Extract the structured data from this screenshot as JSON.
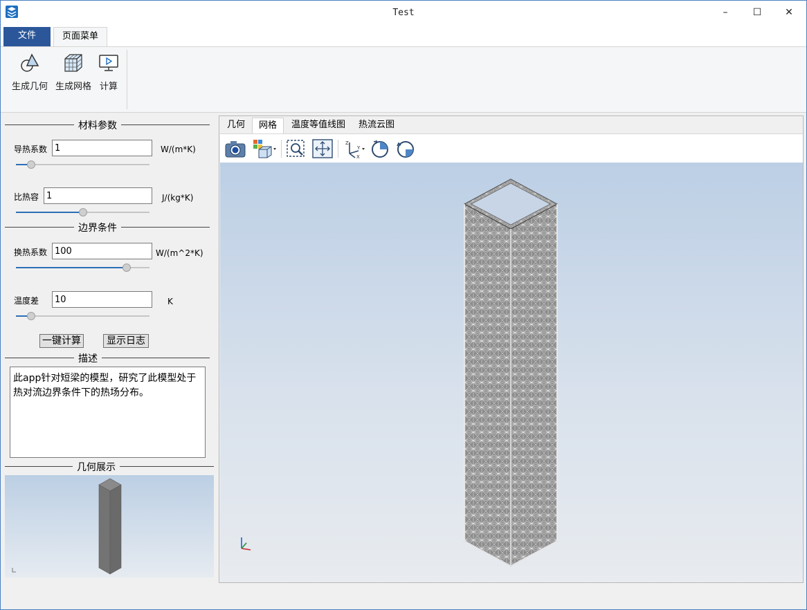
{
  "window": {
    "title": "Test",
    "minimize": "–",
    "maximize": "☐",
    "close": "✕"
  },
  "ribbon": {
    "tabs": [
      {
        "label": "文件"
      },
      {
        "label": "页面菜单"
      }
    ],
    "buttons": [
      {
        "label": "生成几何",
        "icon": "geometry-icon"
      },
      {
        "label": "生成网格",
        "icon": "mesh-cube-icon"
      },
      {
        "label": "计算",
        "icon": "monitor-play-icon"
      }
    ]
  },
  "material": {
    "title": "材料参数",
    "conductivity": {
      "label": "导热系数",
      "value": "1",
      "unit": "W/(m*K)",
      "slider_fraction": 0.09
    },
    "specific_heat": {
      "label": "比热容",
      "value": "1",
      "unit": "J/(kg*K)",
      "slider_fraction": 0.5
    }
  },
  "boundary": {
    "title": "边界条件",
    "htc": {
      "label": "换热系数",
      "value": "100",
      "unit": "W/(m^2*K)",
      "slider_fraction": 0.85
    },
    "temp_diff": {
      "label": "温度差",
      "value": "10",
      "unit": "K",
      "slider_fraction": 0.09
    }
  },
  "actions": {
    "compute": "一键计算",
    "show_log": "显示日志"
  },
  "description": {
    "title": "描述",
    "text": "此app针对短梁的模型，研究了此模型处于热对流边界条件下的热场分布。"
  },
  "geometry_display": {
    "title": "几何展示"
  },
  "viewer": {
    "tabs": [
      {
        "label": "几何"
      },
      {
        "label": "网格"
      },
      {
        "label": "温度等值线图"
      },
      {
        "label": "热流云图"
      }
    ],
    "active_tab": "网格",
    "tools": [
      "camera-icon",
      "view-cube-icon",
      "zoom-box-icon",
      "pan-icon",
      "axes-icon",
      "rotate-cw-icon",
      "rotate-ccw-icon"
    ],
    "axis_labels": {
      "z": "Z",
      "y": "Y",
      "x": "X"
    }
  }
}
